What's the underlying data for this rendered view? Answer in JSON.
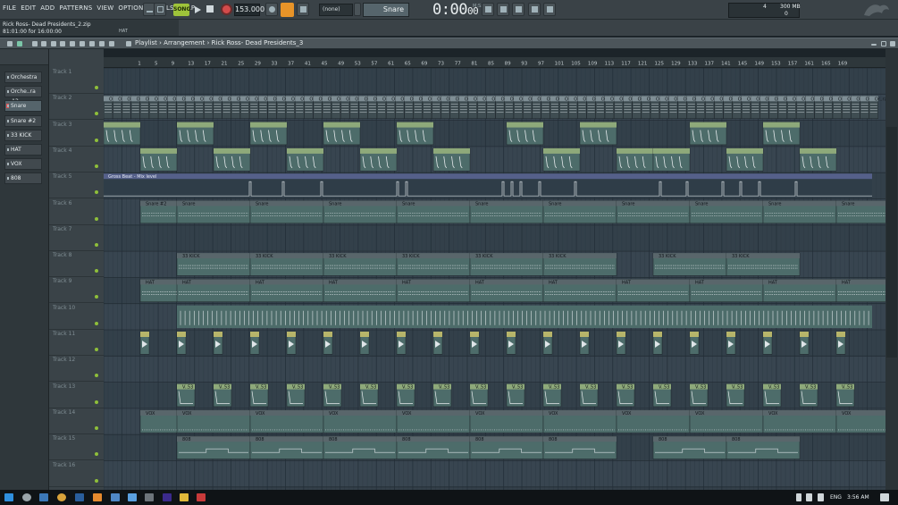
{
  "menu": [
    "FILE",
    "EDIT",
    "ADD",
    "PATTERNS",
    "VIEW",
    "OPTIONS",
    "TOOLS",
    "HELP"
  ],
  "transport": {
    "mode": "SONG",
    "tempo": "153.000",
    "pattern_selector": "(none)",
    "current_pattern": "Snare",
    "time": "0:00",
    "time_fraction": "00",
    "time_unit": "M:S:CS"
  },
  "monitor": {
    "cpu": "4",
    "memory": "300 MB",
    "polyphony": "0"
  },
  "hint": {
    "file": "Rick Ross- Dead Presidents_2.zip",
    "position": "81:01:00 for 16:00:00",
    "channel": "HAT"
  },
  "playlist": {
    "breadcrumb": [
      "Playlist",
      "Arrangement",
      "Rick Ross- Dead Presidents_3"
    ],
    "bar_numbers": [
      "1",
      "5",
      "9",
      "13",
      "17",
      "21",
      "25",
      "29",
      "33",
      "37",
      "41",
      "45",
      "49",
      "53",
      "57",
      "61",
      "65",
      "69",
      "73",
      "77",
      "81",
      "85",
      "89",
      "93",
      "97",
      "101",
      "105",
      "109",
      "113",
      "117",
      "121",
      "125",
      "129",
      "133",
      "137",
      "141",
      "145",
      "149",
      "153",
      "157",
      "161",
      "165",
      "169"
    ],
    "tracks": [
      "Track 1",
      "Track 2",
      "Track 3",
      "Track 4",
      "Track 5",
      "Track 6",
      "Track 7",
      "Track 8",
      "Track 9",
      "Track 10",
      "Track 11",
      "Track 12",
      "Track 13",
      "Track 14",
      "Track 15",
      "Track 16"
    ],
    "automation_label": "Gross Beat - Mix level",
    "clip_labels": {
      "track2": "Or..ra",
      "track6_first": "Snare #2",
      "track6": "Snare",
      "track8": "33 KICK",
      "track9": "HAT",
      "track13": "V..53",
      "track14": "VOX",
      "track15": "808"
    }
  },
  "channels": [
    "Orchestra",
    "Orche..ra #2",
    "Snare",
    "Snare #2",
    "33 KICK",
    "HAT",
    "VOX",
    "808"
  ],
  "taskbar": {
    "language": "ENG",
    "clock": "3:56 AM"
  },
  "colors": {
    "clip_teal": "#4d6c6a",
    "clip_grey": "#59666b",
    "clip_header_green": "#8ea97a",
    "clip_header_yellow": "#b7b56a",
    "automation": "#55608a",
    "song_button": "#9ec33a"
  }
}
